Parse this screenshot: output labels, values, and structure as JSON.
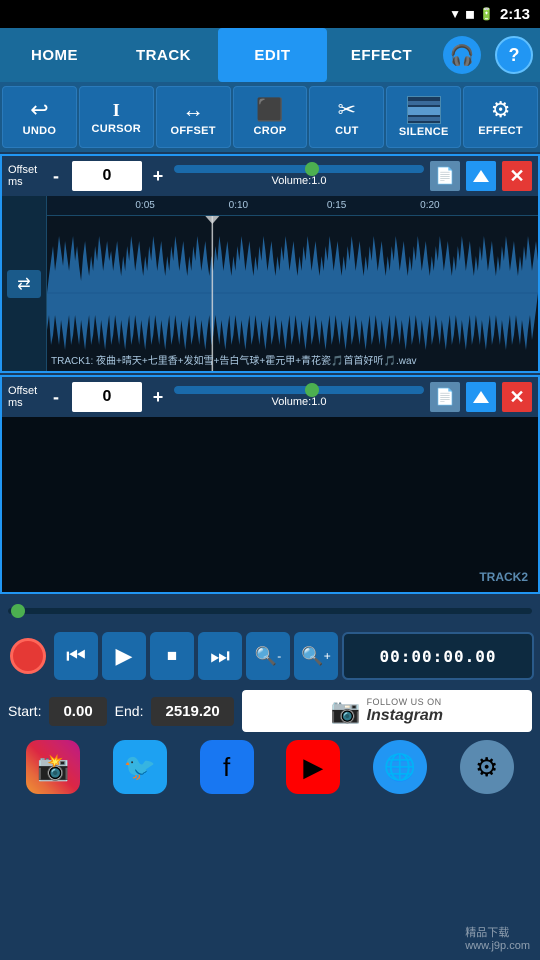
{
  "statusBar": {
    "time": "2:13",
    "icons": [
      "wifi",
      "signal",
      "battery"
    ]
  },
  "nav": {
    "tabs": [
      "HOME",
      "TRACK",
      "EDIT",
      "EFFECT"
    ],
    "activeTab": "EDIT"
  },
  "toolbar": {
    "tools": [
      {
        "id": "undo",
        "label": "UNDO",
        "icon": "↩"
      },
      {
        "id": "cursor",
        "label": "CURSOR",
        "icon": "I"
      },
      {
        "id": "offset",
        "label": "OFFSET",
        "icon": "↔"
      },
      {
        "id": "crop",
        "label": "CROP",
        "icon": "▣"
      },
      {
        "id": "cut",
        "label": "CUT",
        "icon": "✂"
      },
      {
        "id": "silence",
        "label": "SILENCE",
        "icon": "♪"
      },
      {
        "id": "effect",
        "label": "EFFECT",
        "icon": "⚙"
      }
    ]
  },
  "track1": {
    "offsetLabel": "Offset\nms",
    "offsetValue": "0",
    "volumeLabel": "Volume:1.0",
    "filename": "TRACK1: 夜曲+晴天+七里香+发如雪+告白气球+霍元甲+青花瓷🎵首首好听🎵.wav"
  },
  "track2": {
    "offsetLabel": "Offset\nms",
    "offsetValue": "0",
    "volumeLabel": "Volume:1.0",
    "label": "TRACK2"
  },
  "transport": {
    "timeDisplay": "00:00:00.00",
    "startLabel": "Start:",
    "startValue": "0.00",
    "endLabel": "End:",
    "endValue": "2519.20"
  },
  "social": {
    "followText": "FOLLOW US ON",
    "instagramText": "Instagram",
    "buttons": [
      "instagram",
      "twitter",
      "facebook",
      "youtube",
      "web",
      "settings"
    ]
  },
  "timeMarks": [
    "0:05",
    "0:10",
    "0:15",
    "0:20"
  ],
  "watermark": "精品下载\nwww.j9p.com"
}
